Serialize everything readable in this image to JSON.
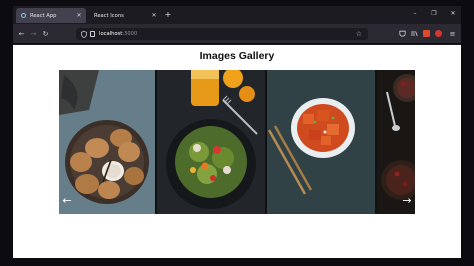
{
  "browser": {
    "tabs": [
      {
        "label": "React App",
        "active": true
      },
      {
        "label": "React Icons",
        "active": false
      }
    ],
    "new_tab_label": "+",
    "window_controls": [
      "–",
      "❐",
      "✕"
    ],
    "url_host": "localhost",
    "url_port": ":3000",
    "colors": {
      "tab_active": "#42414d",
      "toolbar": "#2b2a33",
      "url_field": "#1c1b22"
    }
  },
  "page": {
    "title": "Images Gallery",
    "prev_arrow": "←",
    "next_arrow": "→",
    "images": [
      {
        "name": "cookies-with-dip",
        "subject": "cookies"
      },
      {
        "name": "salad-bowl-with-fork",
        "subject": "salad"
      },
      {
        "name": "tofu-bowl-with-chopsticks",
        "subject": "tofu"
      },
      {
        "name": "dessert-with-spoon",
        "subject": "dessert"
      }
    ]
  }
}
